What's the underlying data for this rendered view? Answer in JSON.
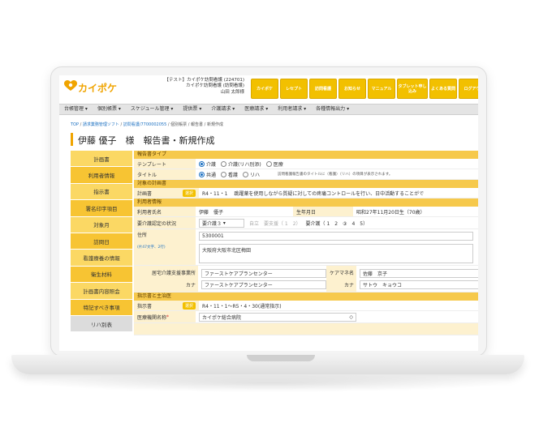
{
  "header": {
    "logo": "カイポケ",
    "account_lines": [
      "【テスト】カイポケ訪問看護 (224701)",
      "カイポケ訪問看護 (訪問看護)",
      "山田 太郎様"
    ],
    "buttons": [
      "カイポケ",
      "レセプト",
      "訪問看護",
      "お知らせ",
      "マニュアル",
      "タブレット申し込み",
      "よくある質問",
      "ログアウト"
    ]
  },
  "nav": [
    "台帳管理",
    "個別帳票",
    "スケジュール管理",
    "提供票",
    "介護請求",
    "医療請求",
    "利用者請求",
    "各種情報出力"
  ],
  "breadcrumb": [
    "TOP",
    "請求業務管理ソフト",
    "訪問看護/7700002055",
    "個別帳票",
    "報告書",
    "新規作成"
  ],
  "page_title": "伊藤 優子　様　報告書・新規作成",
  "side_menu": [
    "計画書",
    "利用者情報",
    "指示書",
    "署名印字項目",
    "対象月",
    "訪問日",
    "看護療養の情報",
    "衛生材料",
    "計画書内容照会",
    "特記すべき事項",
    "リハ別表"
  ],
  "form": {
    "sec_type": "報告書タイプ",
    "template_label": "テンプレート",
    "template_options": [
      "介護",
      "介護(リハ別添)",
      "医療"
    ],
    "title_label": "タイトル",
    "title_options": [
      "共通",
      "看護",
      "リハ"
    ],
    "title_note": "訪問看護報告書のタイトルに（看護）（リハ）の項目が表示されます。",
    "sec_plan": "対象の計画書",
    "plan_label": "計画書",
    "select_btn": "選択",
    "plan_value": "R4・11・1　 跳躍薬を使用しながら質疑に対しての疼痛コントロールを行い、日中活動することがで",
    "sec_user": "利用者情報",
    "name_label": "利用者氏名",
    "name_value": "伊藤　優子",
    "dob_label": "生年月日",
    "dob_value": "昭和27年11月20日生（70歳）",
    "care_label": "要介護認定の状況",
    "care_value": "要介護３",
    "care_scale_a": "自立　要支援（ 1　2）",
    "care_scale_b": "要介護（ 1　2　③　4　5）",
    "addr_label": "住所",
    "addr_hint": "(片47文字、2行)",
    "zip": "5300001",
    "address": "大阪府大阪市北区梅田",
    "office_label": "居宅介護支援事業所",
    "office_value": "ファーストケアプランセンター",
    "office_kana_label": "カナ",
    "office_kana": "ファーストケアプランセンター",
    "cm_label": "ケアマネ名",
    "cm_value": "佐藤　京子",
    "cm_kana_label": "カナ",
    "cm_kana": "サトウ　キョウコ",
    "sec_doc": "指示書と主治医",
    "doc_label": "指示書",
    "doc_value": "R4・11・1〜R5・4・30(通常指示)",
    "hosp_label": "医療機関名称",
    "hosp_value": "カイポケ総合病院"
  }
}
